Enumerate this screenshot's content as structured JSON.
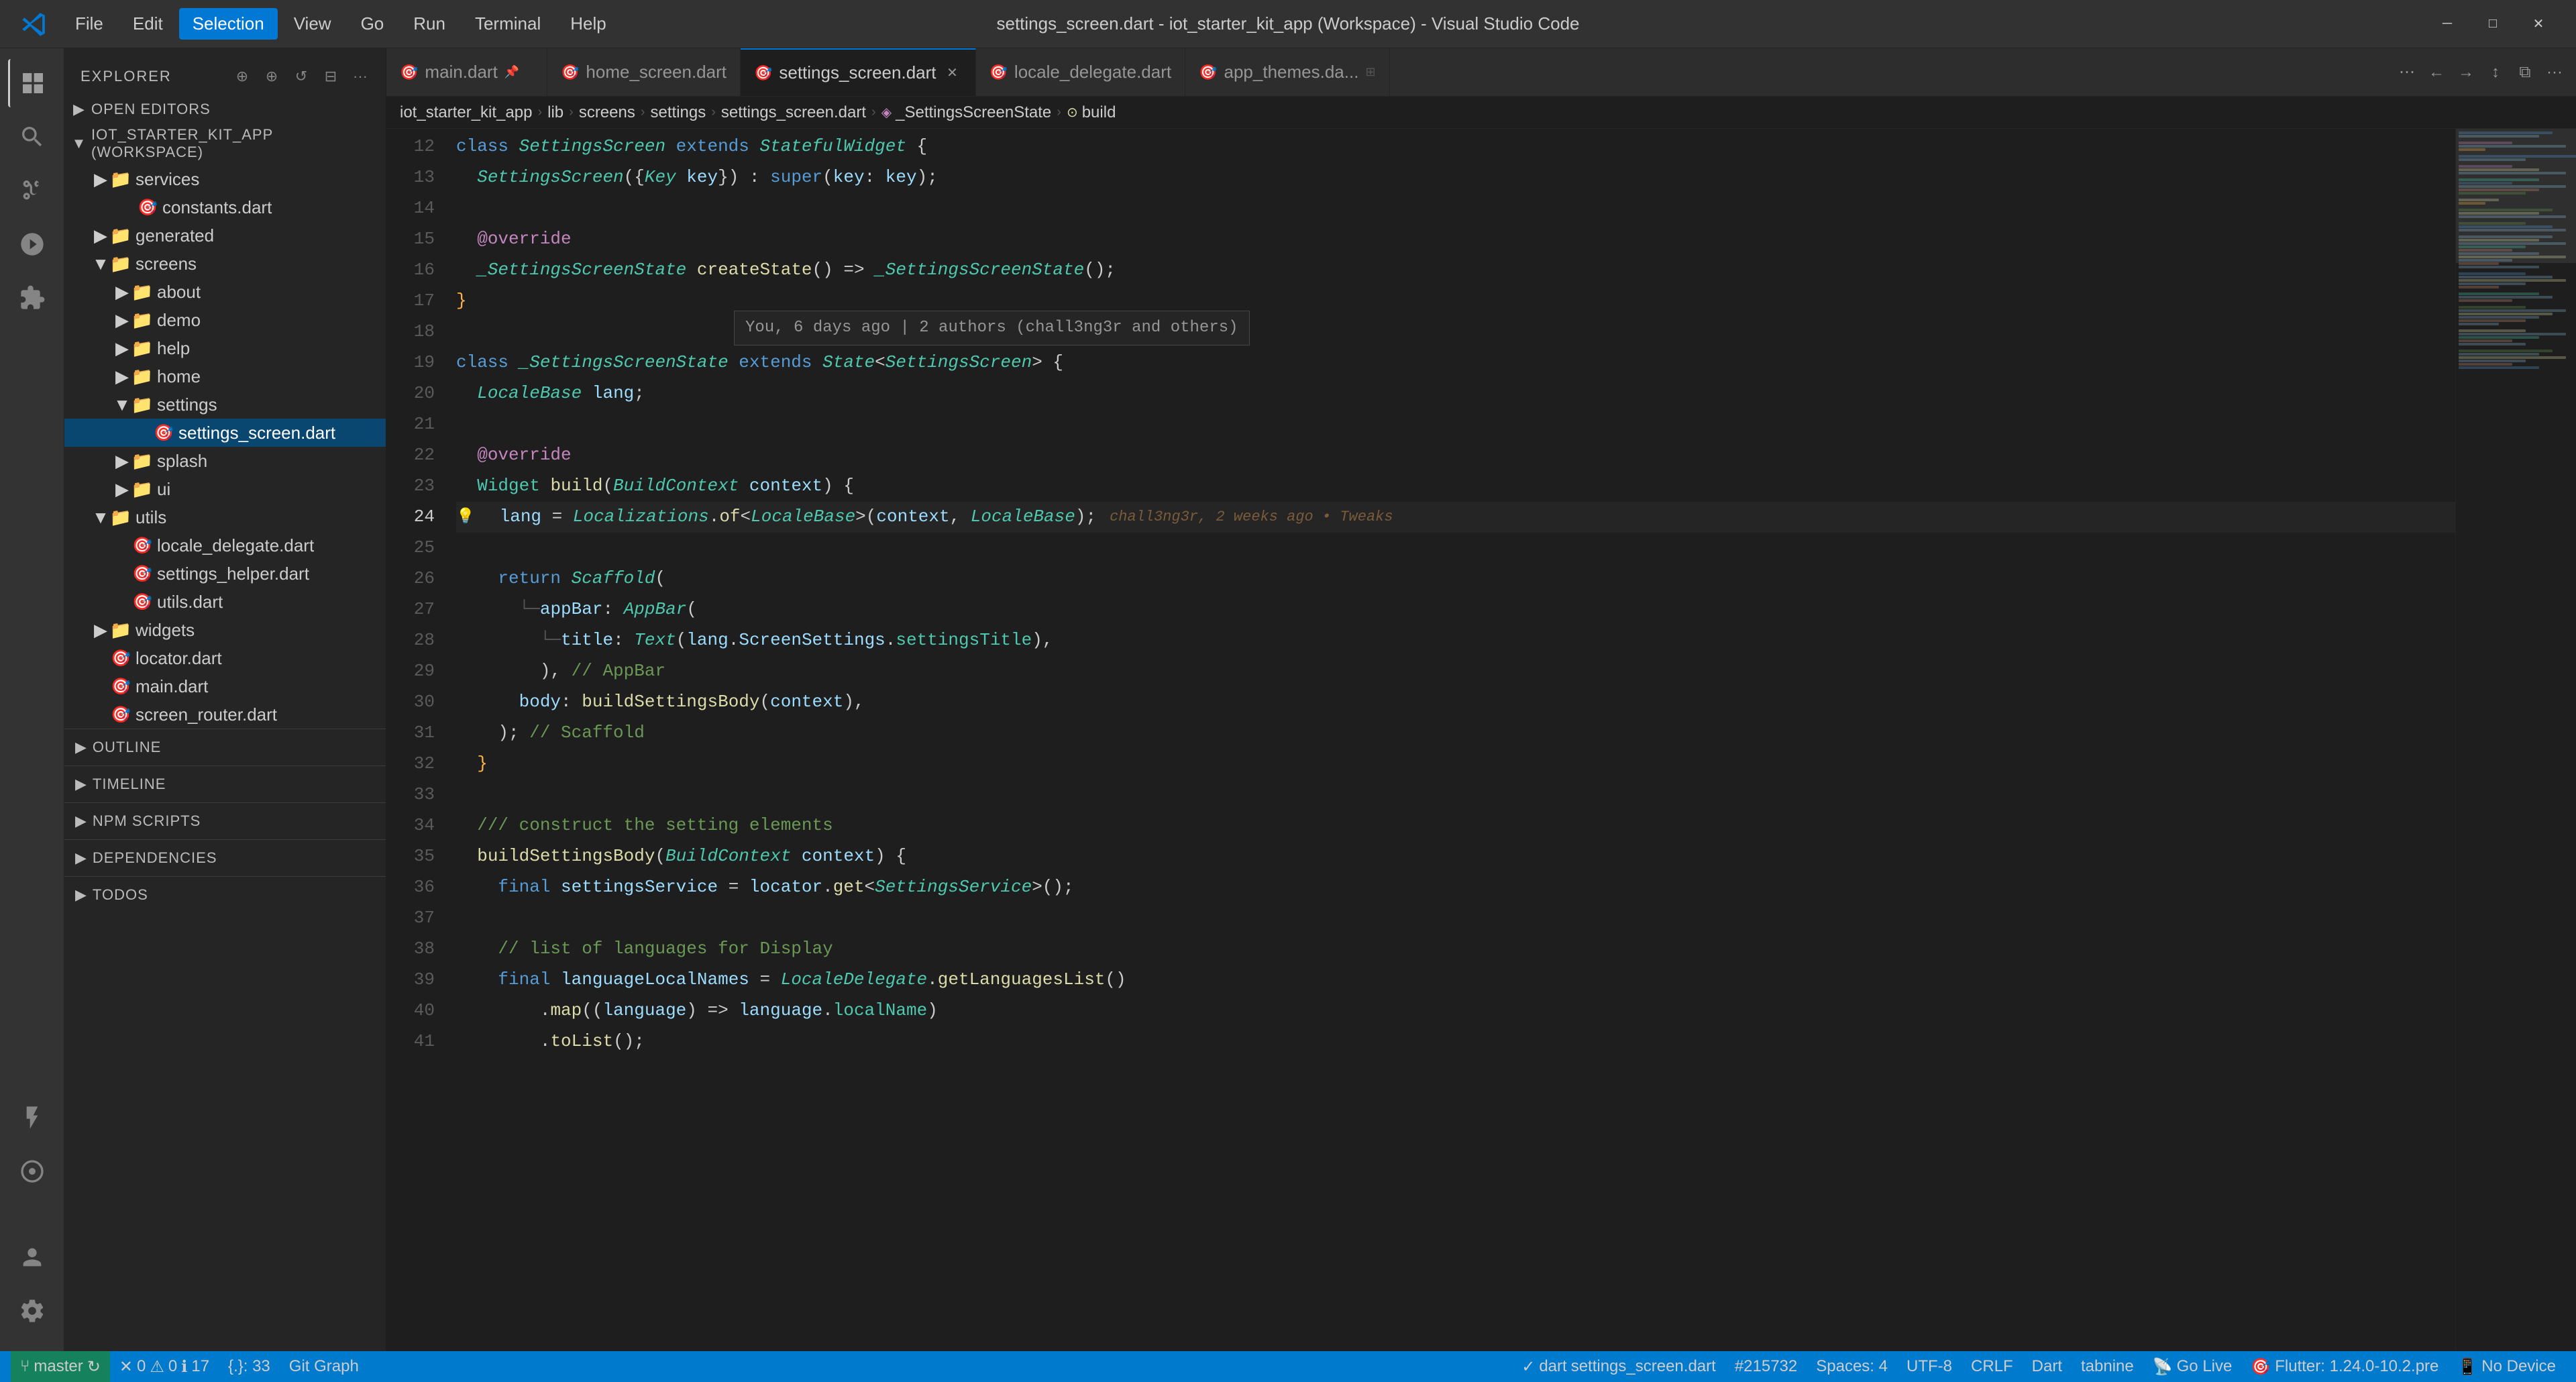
{
  "titlebar": {
    "logo": "vscode-logo",
    "menu": [
      "File",
      "Edit",
      "Selection",
      "View",
      "Go",
      "Run",
      "Terminal",
      "Help"
    ],
    "active_menu": "Selection",
    "title": "settings_screen.dart - iot_starter_kit_app (Workspace) - Visual Studio Code",
    "window_controls": [
      "minimize",
      "maximize",
      "close"
    ]
  },
  "activity_bar": {
    "icons": [
      {
        "name": "explorer-icon",
        "symbol": "📄",
        "active": true
      },
      {
        "name": "search-icon",
        "symbol": "🔍",
        "active": false
      },
      {
        "name": "source-control-icon",
        "symbol": "⑂",
        "active": false
      },
      {
        "name": "run-icon",
        "symbol": "▷",
        "active": false
      },
      {
        "name": "extensions-icon",
        "symbol": "⊞",
        "active": false
      },
      {
        "name": "testing-icon",
        "symbol": "⚗",
        "active": false
      },
      {
        "name": "remote-icon",
        "symbol": "◁▷",
        "active": false
      }
    ],
    "bottom_icons": [
      {
        "name": "accounts-icon",
        "symbol": "👤"
      },
      {
        "name": "settings-icon",
        "symbol": "⚙"
      }
    ]
  },
  "sidebar": {
    "header": "Explorer",
    "open_editors": "Open Editors",
    "workspace_name": "IOT_STARTER_KIT_APP (WORKSPACE)",
    "tree": [
      {
        "label": "services",
        "type": "folder-pink",
        "level": 1,
        "expanded": true
      },
      {
        "label": "constants.dart",
        "type": "dart",
        "level": 2
      },
      {
        "label": "generated",
        "type": "folder-pink",
        "level": 1,
        "expanded": false
      },
      {
        "label": "screens",
        "type": "folder-blue",
        "level": 1,
        "expanded": true
      },
      {
        "label": "about",
        "type": "folder",
        "level": 2,
        "expanded": false
      },
      {
        "label": "demo",
        "type": "folder",
        "level": 2,
        "expanded": false
      },
      {
        "label": "help",
        "type": "folder",
        "level": 2,
        "expanded": false
      },
      {
        "label": "home",
        "type": "folder",
        "level": 2,
        "expanded": false
      },
      {
        "label": "settings",
        "type": "folder-blue",
        "level": 2,
        "expanded": true
      },
      {
        "label": "settings_screen.dart",
        "type": "dart-active",
        "level": 3
      },
      {
        "label": "splash",
        "type": "folder",
        "level": 2,
        "expanded": false
      },
      {
        "label": "ui",
        "type": "folder",
        "level": 2,
        "expanded": false
      },
      {
        "label": "utils",
        "type": "folder-blue",
        "level": 1,
        "expanded": true
      },
      {
        "label": "locale_delegate.dart",
        "type": "dart",
        "level": 2
      },
      {
        "label": "settings_helper.dart",
        "type": "dart",
        "level": 2
      },
      {
        "label": "utils.dart",
        "type": "dart",
        "level": 2
      },
      {
        "label": "widgets",
        "type": "folder",
        "level": 1,
        "expanded": false
      },
      {
        "label": "locator.dart",
        "type": "dart",
        "level": 1
      },
      {
        "label": "main.dart",
        "type": "dart",
        "level": 1
      },
      {
        "label": "screen_router.dart",
        "type": "dart",
        "level": 1
      }
    ],
    "sections": [
      {
        "label": "OUTLINE"
      },
      {
        "label": "TIMELINE"
      },
      {
        "label": "NPM SCRIPTS"
      },
      {
        "label": "DEPENDENCIES"
      },
      {
        "label": "TODOS"
      }
    ]
  },
  "tabs": [
    {
      "label": "main.dart",
      "icon": "dart",
      "active": false,
      "pinned": true,
      "closable": false
    },
    {
      "label": "home_screen.dart",
      "icon": "dart",
      "active": false,
      "closable": false
    },
    {
      "label": "settings_screen.dart",
      "icon": "dart",
      "active": true,
      "closable": true
    },
    {
      "label": "locale_delegate.dart",
      "icon": "dart",
      "active": false,
      "closable": false
    },
    {
      "label": "app_themes.da...",
      "icon": "dart",
      "active": false,
      "closable": false
    }
  ],
  "breadcrumb": [
    {
      "label": "iot_starter_kit_app"
    },
    {
      "label": "lib"
    },
    {
      "label": "screens"
    },
    {
      "label": "settings"
    },
    {
      "label": "settings_screen.dart"
    },
    {
      "label": "_SettingsScreenState"
    },
    {
      "label": "build"
    }
  ],
  "code": {
    "git_lens": "You, 6 days ago | 2 authors (chall3ng3r and others)",
    "git_lens_line24": "chall3ng3r, 2 weeks ago • Tweaks",
    "lines": [
      {
        "num": 12,
        "content": "class _SettingsScreen_ extends _StatefulWidget_ {"
      },
      {
        "num": 13,
        "content": "  _SettingsScreen_({_Key_ key}) : super(key: key);"
      },
      {
        "num": 14,
        "content": ""
      },
      {
        "num": 15,
        "content": "  @override"
      },
      {
        "num": 16,
        "content": "  __SettingsScreenState_ createState() => __SettingsScreenState_();"
      },
      {
        "num": 17,
        "content": "}"
      },
      {
        "num": 18,
        "content": ""
      },
      {
        "num": 19,
        "content": "class __SettingsScreenState_ extends _State_<_SettingsScreen_> {"
      },
      {
        "num": 20,
        "content": "  _LocaleBase_ lang;"
      },
      {
        "num": 21,
        "content": ""
      },
      {
        "num": 22,
        "content": "  @override"
      },
      {
        "num": 23,
        "content": "  Widget build(_BuildContext_ context) {"
      },
      {
        "num": 24,
        "content": "    lang = _Localizations_.of<_LocaleBase_>(context, _LocaleBase_);"
      },
      {
        "num": 25,
        "content": ""
      },
      {
        "num": 26,
        "content": "    return _Scaffold_("
      },
      {
        "num": 27,
        "content": "      └─appBar: _AppBar_("
      },
      {
        "num": 28,
        "content": "        └─title: _Text_(lang._ScreenSettings_.settingsTitle),"
      },
      {
        "num": 29,
        "content": "        ), // AppBar"
      },
      {
        "num": 30,
        "content": "      body: buildSettingsBody(context),"
      },
      {
        "num": 31,
        "content": "    ); // Scaffold"
      },
      {
        "num": 32,
        "content": "  }"
      },
      {
        "num": 33,
        "content": ""
      },
      {
        "num": 34,
        "content": "  /// construct the setting elements"
      },
      {
        "num": 35,
        "content": "  buildSettingsBody(_BuildContext_ context) {"
      },
      {
        "num": 36,
        "content": "    final settingsService = locator.get<_SettingsService_>();"
      },
      {
        "num": 37,
        "content": ""
      },
      {
        "num": 38,
        "content": "    // list of languages for Display"
      },
      {
        "num": 39,
        "content": "    final languageLocalNames = _LocaleDelegate_.getLanguagesList()"
      },
      {
        "num": 40,
        "content": "        .map((language) => language.localName)"
      },
      {
        "num": 41,
        "content": "        .toList();"
      }
    ]
  },
  "status_bar": {
    "branch": "master",
    "errors": "0",
    "warnings": "0",
    "info": "17",
    "cursor": "{.}: 33",
    "git_graph": "Git Graph",
    "language": "dart",
    "file": "settings_screen.dart",
    "encoding": "UTF-8",
    "eol": "CRLF",
    "lang_id": "Dart",
    "go_live": "Go Live",
    "flutter": "Flutter: 1.24.0-10.2.pre",
    "no_device": "No Device",
    "spaces": "Spaces: 4",
    "tabnine": "tabnine",
    "line_col": "#215732"
  }
}
